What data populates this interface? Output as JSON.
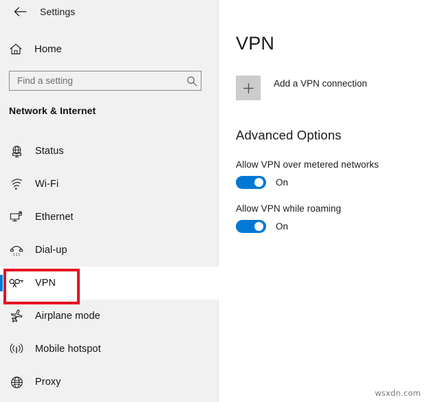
{
  "window": {
    "app_title": "Settings",
    "back_icon": "back-arrow-icon"
  },
  "sidebar": {
    "home": {
      "label": "Home",
      "icon": "home-icon"
    },
    "search": {
      "value": "",
      "placeholder": "Find a setting",
      "icon": "search-icon"
    },
    "group_title": "Network & Internet",
    "items": [
      {
        "label": "Status",
        "icon": "status-globe-monitor-icon",
        "selected": false
      },
      {
        "label": "Wi-Fi",
        "icon": "wifi-icon",
        "selected": false
      },
      {
        "label": "Ethernet",
        "icon": "ethernet-icon",
        "selected": false
      },
      {
        "label": "Dial-up",
        "icon": "dialup-phone-icon",
        "selected": false
      },
      {
        "label": "VPN",
        "icon": "vpn-key-icon",
        "selected": true
      },
      {
        "label": "Airplane mode",
        "icon": "airplane-icon",
        "selected": false
      },
      {
        "label": "Mobile hotspot",
        "icon": "mobile-hotspot-icon",
        "selected": false
      },
      {
        "label": "Proxy",
        "icon": "globe-icon",
        "selected": false
      }
    ]
  },
  "main": {
    "title": "VPN",
    "add_connection": {
      "label": "Add a VPN connection",
      "icon": "plus-icon"
    },
    "section_title": "Advanced Options",
    "options": [
      {
        "label": "Allow VPN over metered networks",
        "state": "On",
        "on": true
      },
      {
        "label": "Allow VPN while roaming",
        "state": "On",
        "on": true
      }
    ]
  },
  "annotation": {
    "highlight_color": "#e81123",
    "target": "VPN"
  },
  "colors": {
    "accent": "#0078d4",
    "sidebar_bg": "#f1f1f1",
    "content_bg": "#ffffff",
    "plus_box": "#cccccc"
  },
  "watermark": {
    "text": "wsxdn.com"
  }
}
